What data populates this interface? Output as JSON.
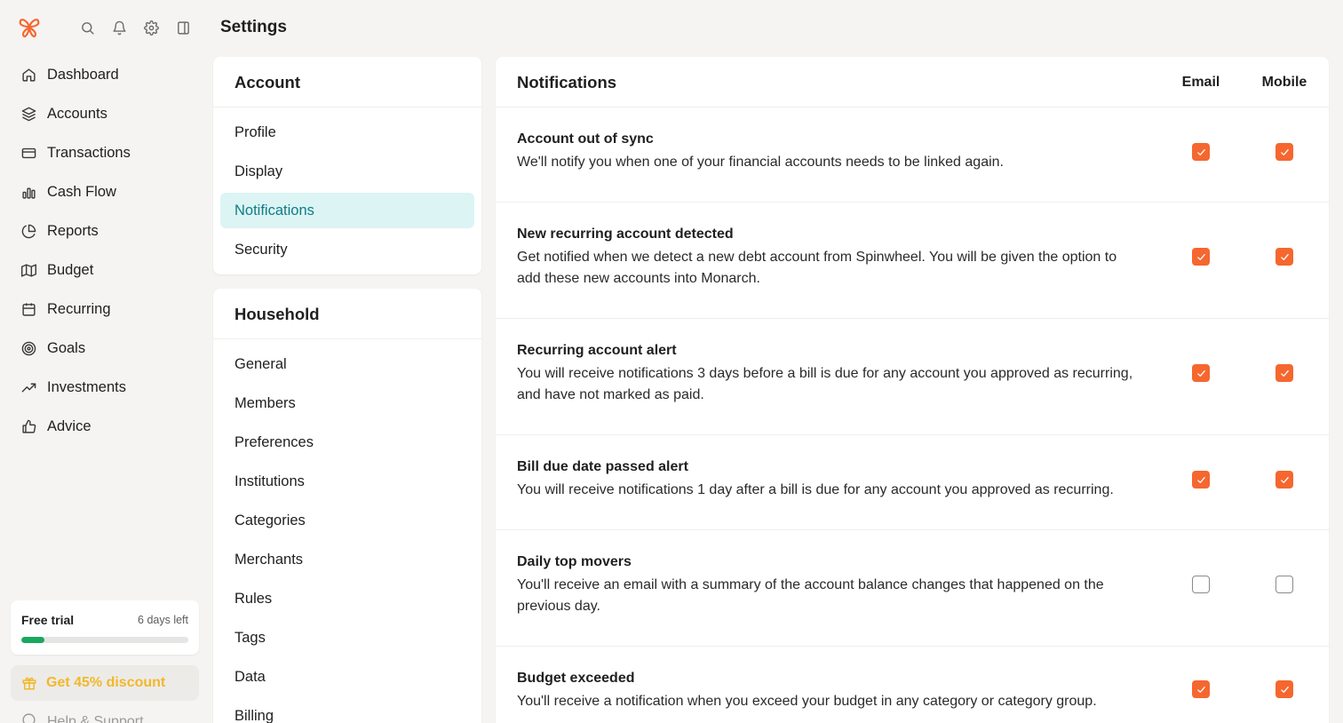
{
  "app": {
    "page_title": "Settings",
    "brand_color": "#f5672f"
  },
  "sidebar": {
    "top_icons": [
      "search-icon",
      "bell-icon",
      "gear-icon",
      "sidebar-toggle-icon"
    ],
    "items": [
      {
        "label": "Dashboard",
        "icon": "home-icon"
      },
      {
        "label": "Accounts",
        "icon": "layers-icon"
      },
      {
        "label": "Transactions",
        "icon": "credit-card-icon"
      },
      {
        "label": "Cash Flow",
        "icon": "bar-chart-icon"
      },
      {
        "label": "Reports",
        "icon": "pie-chart-icon"
      },
      {
        "label": "Budget",
        "icon": "map-icon"
      },
      {
        "label": "Recurring",
        "icon": "calendar-icon"
      },
      {
        "label": "Goals",
        "icon": "target-icon"
      },
      {
        "label": "Investments",
        "icon": "trending-up-icon"
      },
      {
        "label": "Advice",
        "icon": "thumbs-up-icon"
      }
    ],
    "trial": {
      "title": "Free trial",
      "days_left": "6 days left",
      "progress": 0.14
    },
    "discount_label": "Get 45% discount",
    "help_label": "Help & Support"
  },
  "account_menu": {
    "heading": "Account",
    "items": [
      "Profile",
      "Display",
      "Notifications",
      "Security"
    ],
    "active": "Notifications"
  },
  "household_menu": {
    "heading": "Household",
    "items": [
      "General",
      "Members",
      "Preferences",
      "Institutions",
      "Categories",
      "Merchants",
      "Rules",
      "Tags",
      "Data",
      "Billing"
    ]
  },
  "notifications": {
    "heading": "Notifications",
    "col_email": "Email",
    "col_mobile": "Mobile",
    "rows": [
      {
        "title": "Account out of sync",
        "desc": "We'll notify you when one of your financial accounts needs to be linked again.",
        "email": true,
        "mobile": true
      },
      {
        "title": "New recurring account detected",
        "desc": "Get notified when we detect a new debt account from Spinwheel. You will be given the option to add these new accounts into Monarch.",
        "email": true,
        "mobile": true
      },
      {
        "title": "Recurring account alert",
        "desc": "You will receive notifications 3 days before a bill is due for any account you approved as recurring, and have not marked as paid.",
        "email": true,
        "mobile": true
      },
      {
        "title": "Bill due date passed alert",
        "desc": "You will receive notifications 1 day after a bill is due for any account you approved as recurring.",
        "email": true,
        "mobile": true
      },
      {
        "title": "Daily top movers",
        "desc": "You'll receive an email with a summary of the account balance changes that happened on the previous day.",
        "email": false,
        "mobile": false
      },
      {
        "title": "Budget exceeded",
        "desc": "You'll receive a notification when you exceed your budget in any category or category group.",
        "email": true,
        "mobile": true
      }
    ]
  }
}
